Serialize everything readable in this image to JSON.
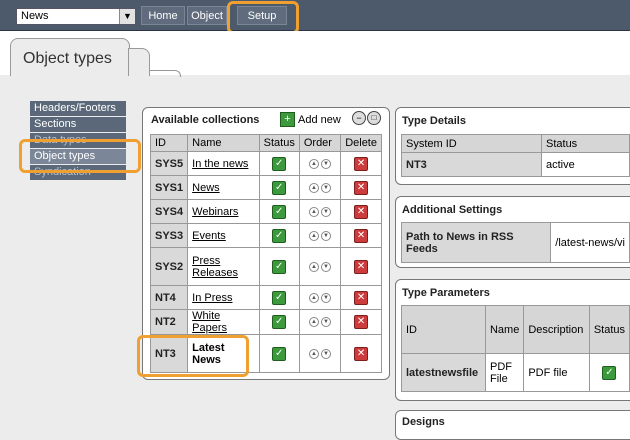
{
  "topbar": {
    "dropdown_value": "News",
    "nav": [
      "Home",
      "Object",
      "Setup"
    ]
  },
  "tab": {
    "title": "Object types"
  },
  "sidebar": {
    "items": [
      {
        "label": "Headers/Footers"
      },
      {
        "label": "Sections"
      },
      {
        "label": "Data types"
      },
      {
        "label": "Object types"
      },
      {
        "label": "Syndication"
      }
    ]
  },
  "collections": {
    "title": "Available collections",
    "add_new": "Add new",
    "columns": [
      "ID",
      "Name",
      "Status",
      "Order",
      "Delete"
    ],
    "rows": [
      {
        "id": "SYS5",
        "name": "In the news"
      },
      {
        "id": "SYS1",
        "name": "News"
      },
      {
        "id": "SYS4",
        "name": "Webinars"
      },
      {
        "id": "SYS3",
        "name": "Events"
      },
      {
        "id": "SYS2",
        "name": "Press Releases"
      },
      {
        "id": "NT4",
        "name": "In Press"
      },
      {
        "id": "NT2",
        "name": "White Papers"
      },
      {
        "id": "NT3",
        "name": "Latest News"
      }
    ]
  },
  "type_details": {
    "title": "Type Details",
    "columns": [
      "System ID",
      "Status"
    ],
    "row": [
      "NT3",
      "active"
    ]
  },
  "additional_settings": {
    "title": "Additional Settings",
    "label": "Path to News in RSS Feeds",
    "value": "/latest-news/vi"
  },
  "type_parameters": {
    "title": "Type Parameters",
    "columns": [
      "ID",
      "Name",
      "Description",
      "Status"
    ],
    "row": [
      "latestnewsfile",
      "PDF File",
      "PDF file"
    ]
  },
  "designs": {
    "title": "Designs"
  },
  "colors": {
    "highlight": "#f0a030",
    "topbar": "#4d5a6b",
    "status_ok": "#3c9a3c",
    "delete": "#cc3c3c"
  }
}
